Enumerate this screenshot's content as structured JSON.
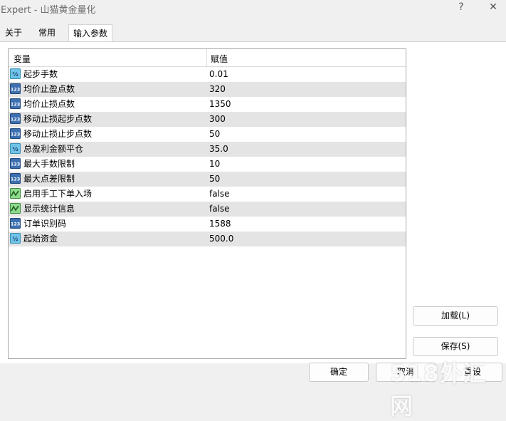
{
  "window": {
    "title": "Expert - 山猫黄金量化",
    "help_label": "?",
    "close_label": "✕"
  },
  "tabs": [
    {
      "label": "关于",
      "active": false
    },
    {
      "label": "常用",
      "active": false
    },
    {
      "label": "输入参数",
      "active": true
    }
  ],
  "grid": {
    "headers": {
      "variable": "变量",
      "value": "赋值"
    },
    "rows": [
      {
        "name": "起步手数",
        "value": "0.01",
        "type": "double"
      },
      {
        "name": "均价止盈点数",
        "value": "320",
        "type": "int"
      },
      {
        "name": "均价止损点数",
        "value": "1350",
        "type": "int"
      },
      {
        "name": "移动止损起步点数",
        "value": "300",
        "type": "int"
      },
      {
        "name": "移动止损止步点数",
        "value": "50",
        "type": "int"
      },
      {
        "name": "总盈利金额平仓",
        "value": "35.0",
        "type": "double"
      },
      {
        "name": "最大手数限制",
        "value": "10",
        "type": "int"
      },
      {
        "name": "最大点差限制",
        "value": "50",
        "type": "int"
      },
      {
        "name": "启用手工下单入场",
        "value": "false",
        "type": "bool"
      },
      {
        "name": "显示统计信息",
        "value": "false",
        "type": "bool"
      },
      {
        "name": "订单识别码",
        "value": "1588",
        "type": "int"
      },
      {
        "name": "起始资金",
        "value": "500.0",
        "type": "double"
      }
    ]
  },
  "icons": {
    "int": "123-int-icon",
    "double": "half-double-icon",
    "bool": "bool-wave-icon"
  },
  "buttons": {
    "load": "加载(L)",
    "save": "保存(S)",
    "ok": "确定",
    "cancel": "取消",
    "reset": "重设"
  },
  "watermark": "518外汇网"
}
